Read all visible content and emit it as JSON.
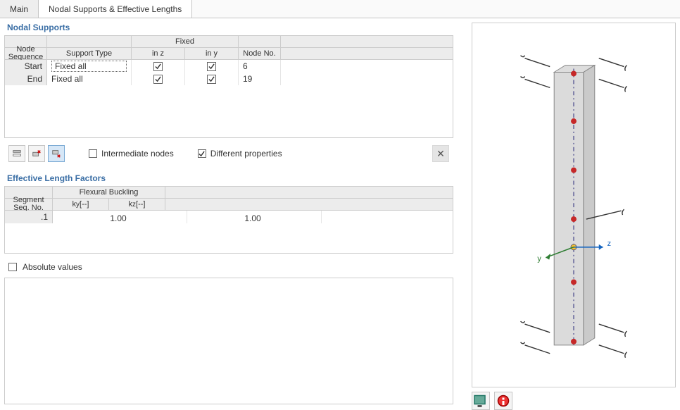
{
  "tabs": {
    "main": "Main",
    "nodal": "Nodal Supports & Effective Lengths"
  },
  "nodal_supports": {
    "title": "Nodal Supports",
    "headers": {
      "node_sequence": "Node Sequence",
      "support_type": "Support Type",
      "fixed": "Fixed",
      "in_z": "in z",
      "in_y": "in y",
      "node_no": "Node No."
    },
    "rows": [
      {
        "seq": "Start",
        "type": "Fixed all",
        "in_z": true,
        "in_y": true,
        "node_no": "6",
        "selected": true
      },
      {
        "seq": "End",
        "type": "Fixed all",
        "in_z": true,
        "in_y": true,
        "node_no": "19",
        "selected": false
      }
    ],
    "options": {
      "intermediate_nodes_label": "Intermediate nodes",
      "intermediate_nodes": false,
      "different_properties_label": "Different properties",
      "different_properties": true
    }
  },
  "effective_lengths": {
    "title": "Effective Length Factors",
    "headers": {
      "segment": "Segment Seq. No.",
      "flexural": "Flexural Buckling",
      "ky": "ky [--]",
      "kz": "kz [--]"
    },
    "rows": [
      {
        "seg": ".1",
        "ky": "1.00",
        "kz": "1.00"
      }
    ],
    "absolute_values_label": "Absolute values",
    "absolute_values": false
  },
  "viewer": {
    "axis_y": "y",
    "axis_z": "z"
  }
}
